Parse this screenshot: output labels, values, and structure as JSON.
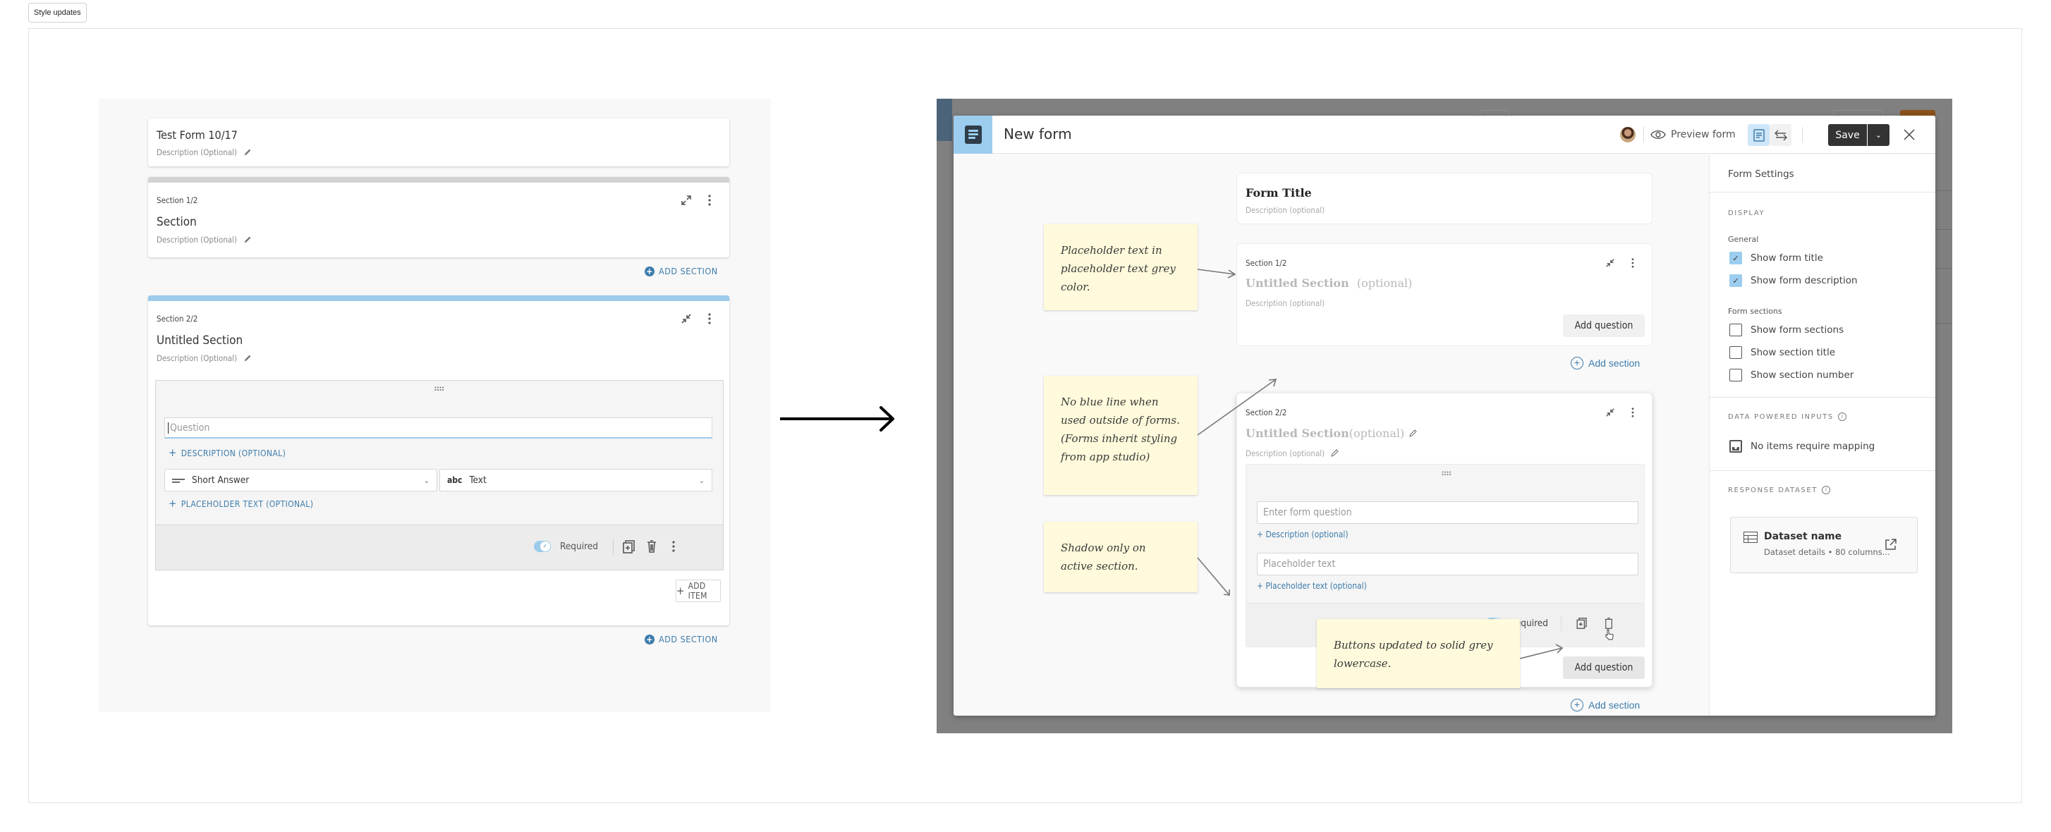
{
  "tag": {
    "label": "Style updates"
  },
  "before": {
    "form": {
      "title": "Test Form 10/17",
      "description": "Description (Optional)"
    },
    "sections": [
      {
        "counter": "Section 1/2",
        "title": "Section",
        "description": "Description (Optional)",
        "add_section": "ADD SECTION"
      },
      {
        "counter": "Section 2/2",
        "title": "Untitled Section",
        "description": "Description (Optional)",
        "item": {
          "question_placeholder": "Question",
          "add_description": "DESCRIPTION (OPTIONAL)",
          "answer_type": "Short Answer",
          "data_type": "Text",
          "add_placeholder": "PLACEHOLDER TEXT (OPTIONAL)",
          "required_label": "Required",
          "required": true
        },
        "add_item": "ADD ITEM",
        "add_section": "ADD SECTION"
      }
    ]
  },
  "after": {
    "modal": {
      "title": "New form",
      "preview_label": "Preview form",
      "save_label": "Save"
    },
    "form": {
      "title": "Form Title",
      "description": "Description (optional)"
    },
    "sections": [
      {
        "counter": "Section 1/2",
        "title": "Untitled Section",
        "title_suffix": "(optional)",
        "description": "Description (optional)",
        "add_question": "Add question",
        "add_section": "Add section"
      },
      {
        "counter": "Section 2/2",
        "title": "Untitled Section",
        "title_suffix": "(optional)",
        "description": "Description (optional)",
        "item": {
          "question_placeholder": "Enter form question",
          "add_description": "+ Description (optional)",
          "placeholder_placeholder": "Placeholder text",
          "add_placeholder": "+ Placeholder text (optional)",
          "required_label": "Required",
          "required": true
        },
        "add_question": "Add question",
        "add_section": "Add section"
      }
    ],
    "settings": {
      "title": "Form Settings",
      "display_caption": "DISPLAY",
      "general_label": "General",
      "general": [
        {
          "label": "Show form title",
          "checked": true
        },
        {
          "label": "Show form description",
          "checked": true
        }
      ],
      "sections_label": "Form sections",
      "section_options": [
        {
          "label": "Show form sections",
          "checked": false
        },
        {
          "label": "Show section title",
          "checked": false
        },
        {
          "label": "Show section number",
          "checked": false
        }
      ],
      "data_inputs_caption": "DATA POWERED INPUTS",
      "no_mapping": "No items require mapping",
      "response_caption": "RESPONSE DATASET",
      "dataset": {
        "name": "Dataset name",
        "meta": "Dataset details • 80 columns..."
      }
    },
    "notes": [
      "Placeholder text in placeholder text grey color.",
      "No blue line when used outside of forms. (Forms inherit styling from app studio)",
      "Shadow only on active section.",
      "Buttons updated to solid grey lowercase."
    ]
  }
}
